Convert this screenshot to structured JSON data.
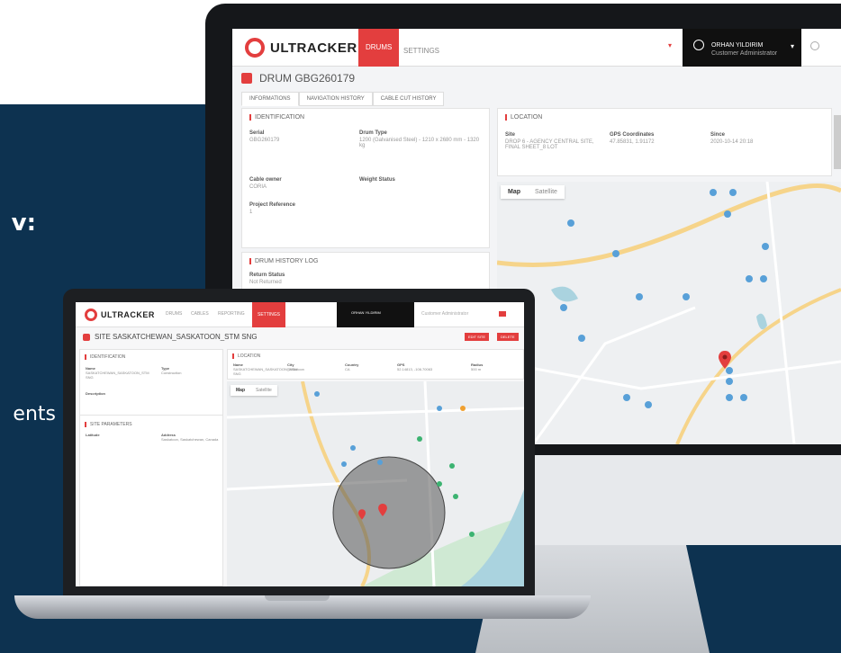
{
  "side_text": {
    "line1": "v:",
    "line2": "ents"
  },
  "imac": {
    "app": {
      "brand": "ULTRACKER",
      "nav": [
        {
          "label": "DRUMS",
          "active": true
        },
        {
          "label": "SETTINGS",
          "active": false
        }
      ],
      "user": {
        "name": "ORHAN YILDIRIM",
        "role": "Customer Administrator"
      },
      "drum_title": "DRUM GBG260179",
      "sub_tabs": [
        "INFORMATIONS",
        "NAVIGATION HISTORY",
        "CABLE CUT HISTORY"
      ],
      "identification": {
        "title": "IDENTIFICATION",
        "fields": [
          {
            "label": "Serial",
            "value": "GBG260179"
          },
          {
            "label": "Drum Type",
            "value": "1200 (Galvanised Steel) - 1210 x 2680 mm - 1320 kg"
          },
          {
            "label": "Cable owner",
            "value": "CORIA"
          },
          {
            "label": "Weight Status",
            "value": ""
          },
          {
            "label": "Project Reference",
            "value": "1"
          }
        ]
      },
      "drum_history_title": "DRUM HISTORY LOG",
      "drum_history_field": {
        "label": "Return Status",
        "value": "Not Returned"
      },
      "location": {
        "title": "LOCATION",
        "fields": [
          {
            "label": "Site",
            "value": "DROP 6 - AGENCY CENTRAL SITE, FINAL SHEET_8 LOT"
          },
          {
            "label": "GPS Coordinates",
            "value": "47.85831, 1.91172"
          },
          {
            "label": "Since",
            "value": "2020-10-14 20:18"
          }
        ]
      },
      "map_tabs": [
        {
          "label": "Map",
          "active": true
        },
        {
          "label": "Satellite",
          "active": false
        }
      ]
    }
  },
  "laptop": {
    "app": {
      "brand": "ULTRACKER",
      "nav": [
        {
          "label": "DRUMS",
          "active": false
        },
        {
          "label": "CABLES",
          "active": false
        },
        {
          "label": "REPORTING",
          "active": false
        },
        {
          "label": "SETTINGS",
          "active": true
        }
      ],
      "user": "ORHAN YILDIRIM",
      "right_text": "Customer Administrator",
      "title": "SITE SASKATCHEWAN_SASKATOON_STM SNG",
      "buttons": [
        "EDIT SITE",
        "DELETE"
      ],
      "identification_title": "IDENTIFICATION",
      "identification": [
        {
          "label": "Name",
          "value": "SASKATCHEWAN_SASKATOON_STM SNG"
        },
        {
          "label": "Type",
          "value": "Construction"
        },
        {
          "label": "Description",
          "value": ""
        }
      ],
      "settings_title": "SITE PARAMETERS",
      "settings": [
        {
          "label": "Latitude",
          "value": ""
        },
        {
          "label": "Address",
          "value": "Saskatoon, Saskatchewan, Canada"
        }
      ],
      "location_title": "LOCATION",
      "location": [
        {
          "label": "Name",
          "value": "SASKATCHEWAN_SASKATOON_STM SNG"
        },
        {
          "label": "City",
          "value": "Saskatoon"
        },
        {
          "label": "Country",
          "value": "CA"
        },
        {
          "label": "GPS",
          "value": "52.14813, -106.70063"
        },
        {
          "label": "Radius",
          "value": "500 m"
        }
      ],
      "map_tabs": [
        {
          "label": "Map",
          "active": true
        },
        {
          "label": "Satellite",
          "active": false
        }
      ]
    }
  },
  "colors": {
    "brand_red": "#e33e3e",
    "navy": "#0d3250",
    "dark_bar": "#101010"
  },
  "icons": [
    "ultracker-logo-icon",
    "user-icon",
    "search-icon",
    "drum-icon",
    "map-pin-icon",
    "apple-logo-icon"
  ]
}
